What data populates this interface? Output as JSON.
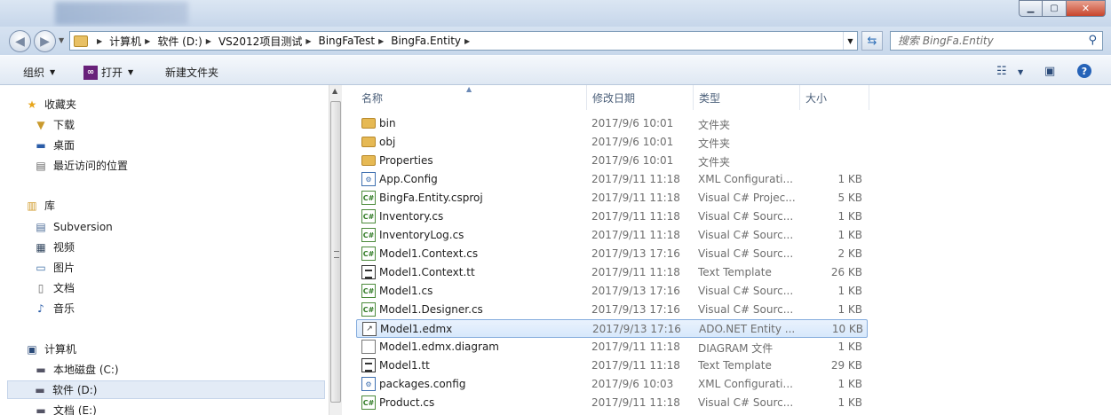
{
  "window": {
    "minimize_glyph": "▁",
    "maximize_glyph": "▢",
    "close_glyph": "✕"
  },
  "address": {
    "segments": [
      "计算机",
      "软件 (D:)",
      "VS2012项目测试",
      "BingFaTest",
      "BingFa.Entity"
    ],
    "search_placeholder": "搜索 BingFa.Entity"
  },
  "toolbar": {
    "organize": "组织",
    "open": "打开",
    "new_folder": "新建文件夹"
  },
  "sidebar": {
    "favorites": {
      "header": "收藏夹",
      "items": [
        "下载",
        "桌面",
        "最近访问的位置"
      ]
    },
    "libraries": {
      "header": "库",
      "items": [
        "Subversion",
        "视频",
        "图片",
        "文档",
        "音乐"
      ]
    },
    "computer": {
      "header": "计算机",
      "items": [
        "本地磁盘 (C:)",
        "软件 (D:)",
        "文档 (E:)"
      ],
      "selected": "软件 (D:)"
    }
  },
  "columns": {
    "name": "名称",
    "date": "修改日期",
    "type": "类型",
    "size": "大小"
  },
  "files": [
    {
      "name": "bin",
      "date": "2017/9/6 10:01",
      "type": "文件夹",
      "size": "",
      "icon": "folder-icon"
    },
    {
      "name": "obj",
      "date": "2017/9/6 10:01",
      "type": "文件夹",
      "size": "",
      "icon": "folder-icon"
    },
    {
      "name": "Properties",
      "date": "2017/9/6 10:01",
      "type": "文件夹",
      "size": "",
      "icon": "folder-icon"
    },
    {
      "name": "App.Config",
      "date": "2017/9/11 11:18",
      "type": "XML Configurati...",
      "size": "1 KB",
      "icon": "xml-config-icon"
    },
    {
      "name": "BingFa.Entity.csproj",
      "date": "2017/9/11 11:18",
      "type": "Visual C# Projec...",
      "size": "5 KB",
      "icon": "csproj-icon"
    },
    {
      "name": "Inventory.cs",
      "date": "2017/9/11 11:18",
      "type": "Visual C# Sourc...",
      "size": "1 KB",
      "icon": "cs-file-icon"
    },
    {
      "name": "InventoryLog.cs",
      "date": "2017/9/11 11:18",
      "type": "Visual C# Sourc...",
      "size": "1 KB",
      "icon": "cs-file-icon"
    },
    {
      "name": "Model1.Context.cs",
      "date": "2017/9/13 17:16",
      "type": "Visual C# Sourc...",
      "size": "2 KB",
      "icon": "cs-file-icon"
    },
    {
      "name": "Model1.Context.tt",
      "date": "2017/9/11 11:18",
      "type": "Text Template",
      "size": "26 KB",
      "icon": "text-template-icon"
    },
    {
      "name": "Model1.cs",
      "date": "2017/9/13 17:16",
      "type": "Visual C# Sourc...",
      "size": "1 KB",
      "icon": "cs-file-icon"
    },
    {
      "name": "Model1.Designer.cs",
      "date": "2017/9/13 17:16",
      "type": "Visual C# Sourc...",
      "size": "1 KB",
      "icon": "cs-file-icon"
    },
    {
      "name": "Model1.edmx",
      "date": "2017/9/13 17:16",
      "type": "ADO.NET Entity ...",
      "size": "10 KB",
      "icon": "edmx-icon",
      "selected": true
    },
    {
      "name": "Model1.edmx.diagram",
      "date": "2017/9/11 11:18",
      "type": "DIAGRAM 文件",
      "size": "1 KB",
      "icon": "blank-file-icon"
    },
    {
      "name": "Model1.tt",
      "date": "2017/9/11 11:18",
      "type": "Text Template",
      "size": "29 KB",
      "icon": "text-template-icon"
    },
    {
      "name": "packages.config",
      "date": "2017/9/6 10:03",
      "type": "XML Configurati...",
      "size": "1 KB",
      "icon": "xml-config-icon"
    },
    {
      "name": "Product.cs",
      "date": "2017/9/11 11:18",
      "type": "Visual C# Sourc...",
      "size": "1 KB",
      "icon": "cs-file-icon"
    }
  ]
}
